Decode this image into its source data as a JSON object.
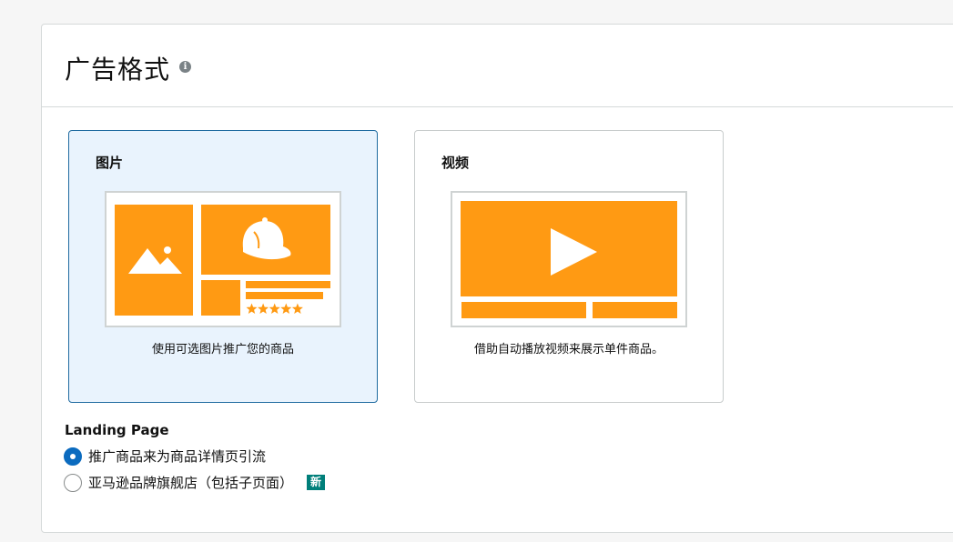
{
  "header": {
    "title": "广告格式",
    "info_icon": "info-icon"
  },
  "formats": [
    {
      "label": "图片",
      "description": "使用可选图片推广您的商品",
      "selected": true
    },
    {
      "label": "视频",
      "description": "借助自动播放视频来展示单件商品。",
      "selected": false
    }
  ],
  "landing": {
    "label": "Landing Page",
    "options": [
      {
        "label": "推广商品来为商品详情页引流",
        "checked": true
      },
      {
        "label": "亚马逊品牌旗舰店（包括子页面）",
        "checked": false,
        "badge": "新"
      }
    ]
  },
  "colors": {
    "accent": "#ff9a13",
    "selected_bg": "#e9f3fd",
    "selected_border": "#1f6ba0",
    "radio": "#0b6bbf",
    "badge": "#007f7a"
  }
}
